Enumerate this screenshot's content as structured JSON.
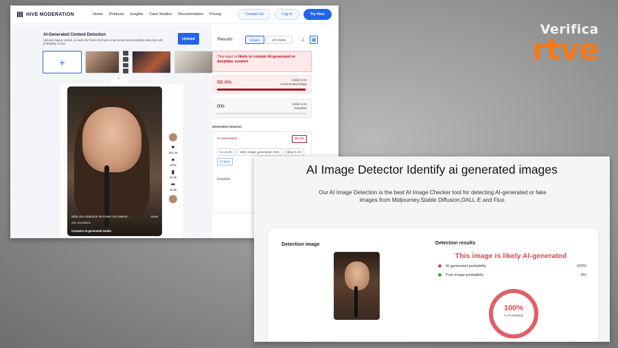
{
  "watermark": {
    "line1": "Verifica",
    "line2": "rtve",
    "color": "#f07b1e"
  },
  "hive": {
    "brand": "HIVE MODERATION",
    "nav": [
      "Home",
      "Products",
      "Insights",
      "Case Studies",
      "Documentation",
      "Pricing"
    ],
    "actions": {
      "contact": "Contact Us",
      "login": "Log In",
      "try": "Try Hive"
    },
    "upload": {
      "title": "AI-Generated Content Detection",
      "description": "Upload images, videos, or audio for frame-by-frame AI-generated and deepfake detection with probability scores",
      "button": "Upload"
    },
    "video": {
      "caption": "Niña con síndrome de Down con talento ...",
      "more": "more",
      "see_translation": "See translation",
      "ai_label": "Contains AI-generated media",
      "counts": [
        "263.4K",
        "1616",
        "20.8K",
        "32.8K"
      ]
    },
    "results": {
      "title": "Results",
      "tab_simple": "Simple",
      "tab_json": "API JSON",
      "alert_prefix": "This input is ",
      "alert_bold": "likely to contain AI-generated or deepfake content",
      "ai_score": "98.4%",
      "ai_score_fraction": 0.984,
      "ai_label_line1": "Likely to be",
      "ai_label_line2": "AI-Generated Image",
      "df_score": "0%",
      "df_score_fraction": 0.0,
      "df_label_line1": "Likely to be",
      "df_label_line2": "Deepfake",
      "gen_title": "Generation Sources",
      "gen_name": "AI-Generated",
      "gen_score": "98.4%",
      "gen_tags": [
        "4o: 11.3%",
        "other_image_generators: 3.5%",
        "kling: 3.1%",
        "97 More"
      ],
      "deepfake": "Deepfake"
    },
    "accent": "#2563eb",
    "danger": "#b0121f"
  },
  "detector": {
    "title": "AI Image Detector Identify ai generated images",
    "description": "Our AI Image Detection is the best AI Image Checker tool for detecting AI-generated or fake images from Midjourney,Stable Diffusion,DALL·E and Flux.",
    "detection_image": "Detection image",
    "detection_results": "Detection results",
    "verdict": "This image is likely AI-generated",
    "rows": [
      {
        "label": "AI generated probability",
        "value": "100%",
        "color": "#e0454f"
      },
      {
        "label": "True image probability",
        "value": "0%",
        "color": "#2aa64a"
      }
    ],
    "gauge_value": "100%",
    "gauge_fraction": 1.0,
    "gauge_label": "AI Probability",
    "accent": "#e0454f"
  }
}
